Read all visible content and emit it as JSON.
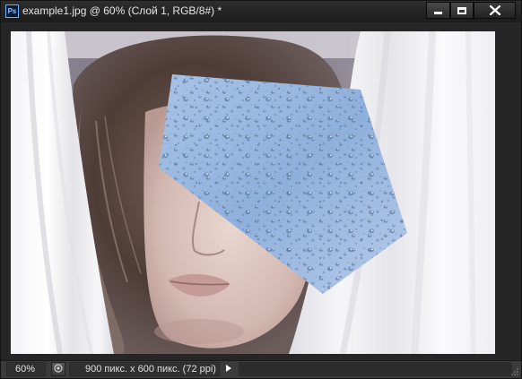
{
  "window": {
    "app_icon_label": "Ps",
    "title": "example1.jpg @ 60% (Слой 1, RGB/8#) *",
    "controls": {
      "minimize": "minimize-icon",
      "maximize": "maximize-icon",
      "close": "close-icon"
    }
  },
  "canvas": {
    "content": "photo of woman behind white curtains with a pentagon-shaped water-drops glass texture over her eyes"
  },
  "statusbar": {
    "zoom": "60%",
    "doc_info": "900 пикс. x 600 пикс. (72 ppi)"
  },
  "colors": {
    "titlebar": "#1c1c1c",
    "statusbar": "#3b3b3b",
    "ps_icon_border": "#6fb1ff"
  }
}
